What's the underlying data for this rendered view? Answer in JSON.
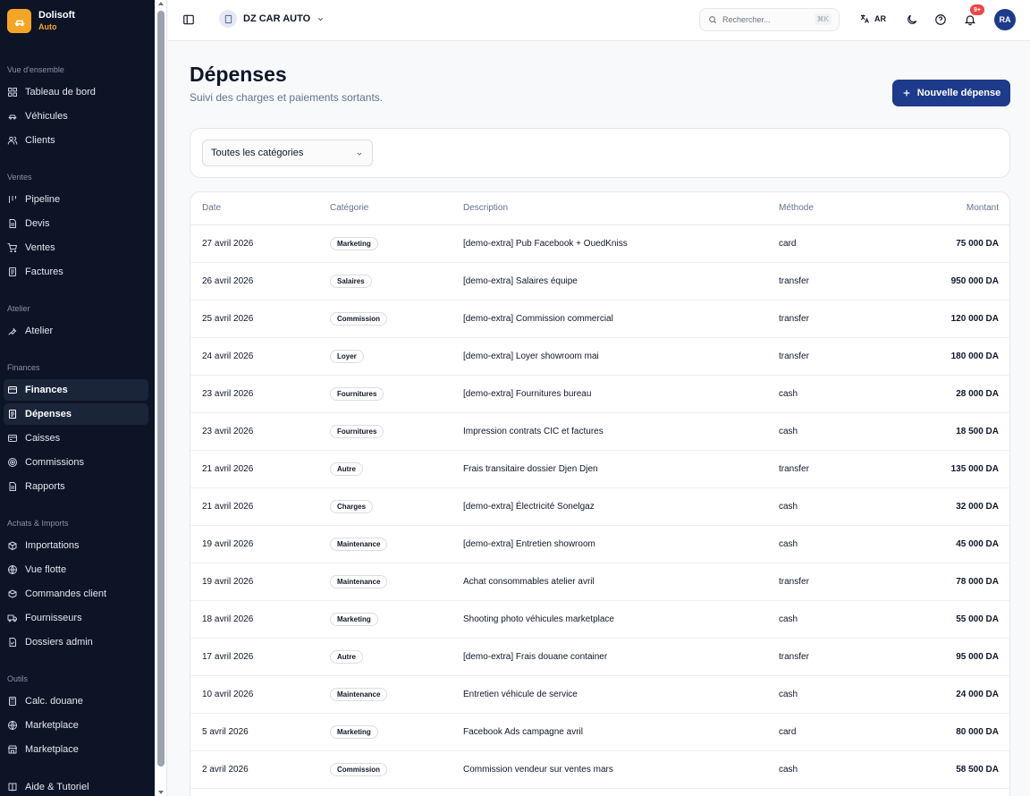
{
  "brand": {
    "name": "Dolisoft",
    "sub": "Auto"
  },
  "sidebar": {
    "sections": [
      {
        "label": "Vue d'ensemble",
        "items": [
          {
            "label": "Tableau de bord",
            "icon": "grid-icon"
          },
          {
            "label": "Véhicules",
            "icon": "car-icon"
          },
          {
            "label": "Clients",
            "icon": "users-icon"
          }
        ]
      },
      {
        "label": "Ventes",
        "items": [
          {
            "label": "Pipeline",
            "icon": "pipeline-icon"
          },
          {
            "label": "Devis",
            "icon": "document-icon"
          },
          {
            "label": "Ventes",
            "icon": "cart-icon"
          },
          {
            "label": "Factures",
            "icon": "receipt-icon"
          }
        ]
      },
      {
        "label": "Atelier",
        "items": [
          {
            "label": "Atelier",
            "icon": "wrench-icon"
          }
        ]
      },
      {
        "label": "Finances",
        "items": [
          {
            "label": "Finances",
            "icon": "wallet-icon",
            "active": true
          },
          {
            "label": "Dépenses",
            "icon": "receipt-icon",
            "active": true
          },
          {
            "label": "Caisses",
            "icon": "cashbox-icon"
          },
          {
            "label": "Commissions",
            "icon": "target-icon"
          },
          {
            "label": "Rapports",
            "icon": "document-icon"
          }
        ]
      },
      {
        "label": "Achats & Imports",
        "items": [
          {
            "label": "Importations",
            "icon": "package-icon"
          },
          {
            "label": "Vue flotte",
            "icon": "globe-icon"
          },
          {
            "label": "Commandes client",
            "icon": "box-icon"
          },
          {
            "label": "Fournisseurs",
            "icon": "truck-icon"
          },
          {
            "label": "Dossiers admin",
            "icon": "file-check-icon"
          }
        ]
      },
      {
        "label": "Outils",
        "items": [
          {
            "label": "Calc. douane",
            "icon": "calculator-icon"
          },
          {
            "label": "Marketplace",
            "icon": "globe-icon"
          },
          {
            "label": "Marketplace",
            "icon": "store-icon"
          }
        ]
      }
    ],
    "footer_item": {
      "label": "Aide & Tutoriel",
      "icon": "book-icon"
    }
  },
  "topbar": {
    "company": "DZ CAR AUTO",
    "search_placeholder": "Rechercher...",
    "search_shortcut": "⌘K",
    "lang": "AR",
    "notif_count": "9+",
    "user_initials": "RA"
  },
  "page": {
    "title": "Dépenses",
    "subtitle": "Suivi des charges et paiements sortants.",
    "new_button": "Nouvelle dépense"
  },
  "filter": {
    "category_value": "Toutes les catégories"
  },
  "table": {
    "columns": {
      "date": "Date",
      "category": "Catégorie",
      "description": "Description",
      "method": "Méthode",
      "amount": "Montant"
    },
    "rows": [
      {
        "date": "27 avril 2026",
        "category": "Marketing",
        "description": "[demo-extra] Pub Facebook + OuedKniss",
        "method": "card",
        "amount": "75 000 DA"
      },
      {
        "date": "26 avril 2026",
        "category": "Salaires",
        "description": "[demo-extra] Salaires équipe",
        "method": "transfer",
        "amount": "950 000 DA"
      },
      {
        "date": "25 avril 2026",
        "category": "Commission",
        "description": "[demo-extra] Commission commercial",
        "method": "transfer",
        "amount": "120 000 DA"
      },
      {
        "date": "24 avril 2026",
        "category": "Loyer",
        "description": "[demo-extra] Loyer showroom mai",
        "method": "transfer",
        "amount": "180 000 DA"
      },
      {
        "date": "23 avril 2026",
        "category": "Fournitures",
        "description": "[demo-extra] Fournitures bureau",
        "method": "cash",
        "amount": "28 000 DA"
      },
      {
        "date": "23 avril 2026",
        "category": "Fournitures",
        "description": "Impression contrats CIC et factures",
        "method": "cash",
        "amount": "18 500 DA"
      },
      {
        "date": "21 avril 2026",
        "category": "Autre",
        "description": "Frais transitaire dossier Djen Djen",
        "method": "transfer",
        "amount": "135 000 DA"
      },
      {
        "date": "21 avril 2026",
        "category": "Charges",
        "description": "[demo-extra] Électricité Sonelgaz",
        "method": "cash",
        "amount": "32 000 DA"
      },
      {
        "date": "19 avril 2026",
        "category": "Maintenance",
        "description": "[demo-extra] Entretien showroom",
        "method": "cash",
        "amount": "45 000 DA"
      },
      {
        "date": "19 avril 2026",
        "category": "Maintenance",
        "description": "Achat consommables atelier avril",
        "method": "transfer",
        "amount": "78 000 DA"
      },
      {
        "date": "18 avril 2026",
        "category": "Marketing",
        "description": "Shooting photo véhicules marketplace",
        "method": "cash",
        "amount": "55 000 DA"
      },
      {
        "date": "17 avril 2026",
        "category": "Autre",
        "description": "[demo-extra] Frais douane container",
        "method": "transfer",
        "amount": "95 000 DA"
      },
      {
        "date": "10 avril 2026",
        "category": "Maintenance",
        "description": "Entretien véhicule de service",
        "method": "cash",
        "amount": "24 000 DA"
      },
      {
        "date": "5 avril 2026",
        "category": "Marketing",
        "description": "Facebook Ads campagne avril",
        "method": "card",
        "amount": "80 000 DA"
      },
      {
        "date": "2 avril 2026",
        "category": "Commission",
        "description": "Commission vendeur sur ventes mars",
        "method": "cash",
        "amount": "58 500 DA"
      }
    ]
  }
}
